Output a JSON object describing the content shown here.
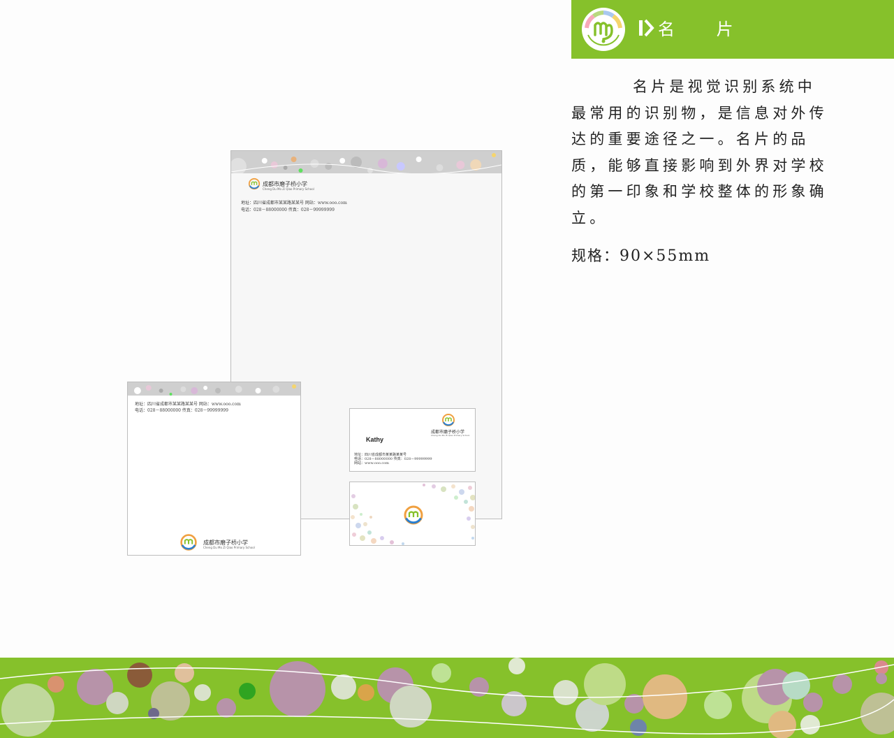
{
  "header": {
    "title": "名 片",
    "accent_color": "#86c12b",
    "logo_icon": "school-logo-icon",
    "arrow_icon": "double-chevron-right-icon"
  },
  "description": {
    "paragraph": "名片是视觉识别系统中最常用的识别物，是信息对外传达的重要途径之一。名片的品质，能够直接影响到外界对学校的第一印象和学校整体的形象确立。",
    "spec_label": "规格：",
    "spec_value": "90×55mm"
  },
  "letterhead": {
    "school_name_cn": "成都市磨子桥小学",
    "school_name_en": "Cheng Du Mo Zi Qiao Primary School",
    "address_line": "地址：四川省成都市某某路某某号  网站：www.ooo.com",
    "phone_line": "电话：028－88000000 传真：028－99999999"
  },
  "memo": {
    "address_line": "地址：四川省成都市某某路某某号  网站：www.ooo.com",
    "phone_line": "电话：028－88000000 传真：028－99999999",
    "school_name_cn": "成都市磨子桥小学",
    "school_name_en": "Cheng Du Mo Zi Qiao Primary School"
  },
  "business_card": {
    "name": "Kathy",
    "school_name_cn": "成都市磨子桥小学",
    "school_name_en": "Cheng Du Mo Zi Qiao Primary School",
    "address_line": "地址：四川省成都市某某路某某号",
    "phone_line": "电话：028－88000000 传真：028－99999999",
    "web_line": "网站：www.ooo.com"
  },
  "footer": {
    "background_color": "#86c12b",
    "decoration": "colored-circles-pattern"
  }
}
